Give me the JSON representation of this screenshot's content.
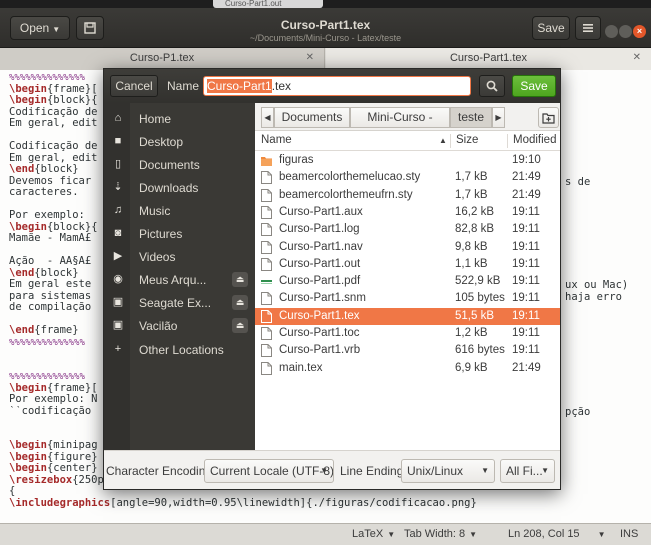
{
  "background_window": {
    "file_label": "Curso-Part1.out"
  },
  "headerbar": {
    "open_label": "Open",
    "title": "Curso-Part1.tex",
    "subtitle": "~/Documents/Mini-Curso - Latex/teste",
    "save_label": "Save"
  },
  "tabs": [
    {
      "label": "Curso-P1.tex"
    },
    {
      "label": "Curso-Part1.tex"
    }
  ],
  "editor": {
    "lines": [
      {
        "kind": "comment",
        "text": "%%%%%%%%%%%%%%"
      },
      {
        "kind": "cmd",
        "cmd": "\\begin",
        "text": "{frame}["
      },
      {
        "kind": "cmd",
        "cmd": "\\begin",
        "text": "{block}{"
      },
      {
        "kind": "text",
        "text": "Codificação de"
      },
      {
        "kind": "text",
        "text": "Em geral, edit"
      },
      {
        "kind": "text",
        "text": ""
      },
      {
        "kind": "text",
        "text": "Codificação de"
      },
      {
        "kind": "text",
        "text": "Em geral, edit"
      },
      {
        "kind": "cmd",
        "cmd": "\\end",
        "text": "{block}"
      },
      {
        "kind": "text",
        "text": "Devemos ficar"
      },
      {
        "kind": "text",
        "text": "caracteres."
      },
      {
        "kind": "text",
        "text": ""
      },
      {
        "kind": "text",
        "text": "Por exemplo:"
      },
      {
        "kind": "cmd",
        "cmd": "\\begin",
        "text": "{block}{"
      },
      {
        "kind": "text",
        "text": "Mamãe - MamÃ£"
      },
      {
        "kind": "text",
        "text": ""
      },
      {
        "kind": "text",
        "text": "Ação  - AÃ§Ã£"
      },
      {
        "kind": "cmd",
        "cmd": "\\end",
        "text": "{block}"
      },
      {
        "kind": "text",
        "text": "Em geral este"
      },
      {
        "kind": "text",
        "text": "para sistemas"
      },
      {
        "kind": "text",
        "text": "de compilação"
      },
      {
        "kind": "text",
        "text": ""
      },
      {
        "kind": "cmd",
        "cmd": "\\end",
        "text": "{frame}"
      },
      {
        "kind": "comment",
        "text": "%%%%%%%%%%%%%%"
      },
      {
        "kind": "text",
        "text": ""
      },
      {
        "kind": "text",
        "text": ""
      },
      {
        "kind": "comment",
        "text": "%%%%%%%%%%%%%%"
      },
      {
        "kind": "cmd",
        "cmd": "\\begin",
        "text": "{frame}["
      },
      {
        "kind": "text",
        "text": "Por exemplo: N"
      },
      {
        "kind": "text",
        "text": "``codificação"
      },
      {
        "kind": "text",
        "text": ""
      },
      {
        "kind": "text",
        "text": ""
      },
      {
        "kind": "cmd",
        "cmd": "\\begin",
        "text": "{minipag"
      },
      {
        "kind": "cmd",
        "cmd": "\\begin",
        "text": "{figure}"
      },
      {
        "kind": "cmd",
        "cmd": "\\begin",
        "text": "{center}"
      },
      {
        "kind": "cmd",
        "cmd": "\\resizebox",
        "text": "{250pt}{!}"
      },
      {
        "kind": "text",
        "text": "{"
      },
      {
        "kind": "cmd",
        "cmd": "\\includegraphics",
        "text": "[angle=90,width=0.95\\linewidth]{./figuras/codificacao.png}"
      }
    ],
    "right_fragments": [
      {
        "line": 9,
        "text": "s de"
      },
      {
        "line": 18,
        "text": "ux ou Mac)"
      },
      {
        "line": 19,
        "text": "haja erro"
      },
      {
        "line": 29,
        "text": "pção"
      }
    ]
  },
  "dialog": {
    "cancel_label": "Cancel",
    "name_label": "Name",
    "name_selected": "Curso-Part1",
    "name_rest": ".tex",
    "save_label": "Save",
    "places": [
      {
        "label": "Home",
        "icon": "home-icon",
        "eject": false
      },
      {
        "label": "Desktop",
        "icon": "desktop-folder-icon",
        "eject": false
      },
      {
        "label": "Documents",
        "icon": "document-icon",
        "eject": false
      },
      {
        "label": "Downloads",
        "icon": "download-icon",
        "eject": false
      },
      {
        "label": "Music",
        "icon": "music-icon",
        "eject": false
      },
      {
        "label": "Pictures",
        "icon": "camera-icon",
        "eject": false
      },
      {
        "label": "Videos",
        "icon": "video-icon",
        "eject": false
      },
      {
        "label": "Meus Arqu...",
        "icon": "optical-disc-icon",
        "eject": true
      },
      {
        "label": "Seagate Ex...",
        "icon": "drive-icon",
        "eject": true
      },
      {
        "label": "Vacilão",
        "icon": "drive-icon",
        "eject": true
      },
      {
        "label": "Other Locations",
        "icon": "plus-icon",
        "eject": false
      }
    ],
    "pathbar": [
      "Documents",
      "Mini-Curso - Latex",
      "teste"
    ],
    "columns": {
      "name": "Name",
      "size": "Size",
      "modified": "Modified"
    },
    "files": [
      {
        "name": "figuras",
        "size": "",
        "modified": "19:10",
        "type": "folder"
      },
      {
        "name": "beamercolorthemelucao.sty",
        "size": "1,7 kB",
        "modified": "21:49",
        "type": "file"
      },
      {
        "name": "beamercolorthemeufrn.sty",
        "size": "1,7 kB",
        "modified": "21:49",
        "type": "file"
      },
      {
        "name": "Curso-Part1.aux",
        "size": "16,2 kB",
        "modified": "19:11",
        "type": "file"
      },
      {
        "name": "Curso-Part1.log",
        "size": "82,8 kB",
        "modified": "19:11",
        "type": "file"
      },
      {
        "name": "Curso-Part1.nav",
        "size": "9,8 kB",
        "modified": "19:11",
        "type": "file"
      },
      {
        "name": "Curso-Part1.out",
        "size": "1,1 kB",
        "modified": "19:11",
        "type": "file"
      },
      {
        "name": "Curso-Part1.pdf",
        "size": "522,9 kB",
        "modified": "19:11",
        "type": "pdf"
      },
      {
        "name": "Curso-Part1.snm",
        "size": "105 bytes",
        "modified": "19:11",
        "type": "file"
      },
      {
        "name": "Curso-Part1.tex",
        "size": "51,5 kB",
        "modified": "19:11",
        "type": "file",
        "selected": true
      },
      {
        "name": "Curso-Part1.toc",
        "size": "1,2 kB",
        "modified": "19:11",
        "type": "file"
      },
      {
        "name": "Curso-Part1.vrb",
        "size": "616 bytes",
        "modified": "19:11",
        "type": "file"
      },
      {
        "name": "main.tex",
        "size": "6,9 kB",
        "modified": "21:49",
        "type": "file"
      }
    ],
    "footer": {
      "encoding_label": "Character Encoding:",
      "encoding_value": "Current Locale (UTF-8)",
      "line_ending_label": "Line Ending:",
      "line_ending_value": "Unix/Linux",
      "filter_value": "All Fi..."
    }
  },
  "statusbar": {
    "language": "LaTeX",
    "tab_width": "Tab Width: 8",
    "position": "Ln 208, Col 15",
    "mode": "INS"
  },
  "colors": {
    "accent": "#f07746",
    "save_green": "#5bb12b",
    "header_dark": "#3b3a37",
    "sidebar_dark": "#3a3935",
    "latex_keyword": "#a52a2a",
    "latex_comment": "#8b3a8b"
  }
}
